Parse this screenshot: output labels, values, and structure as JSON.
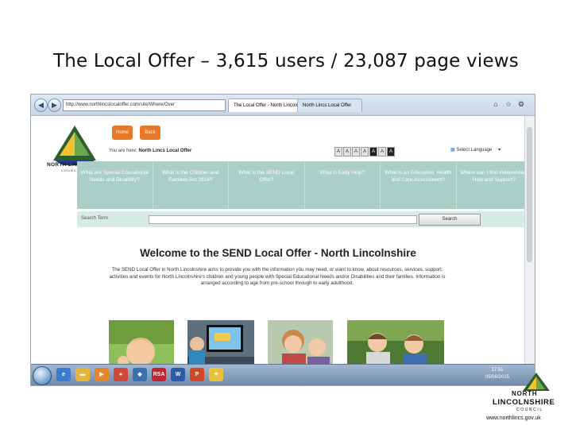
{
  "slide": {
    "title": "The Local Offer – 3,615 users / 23,087 page views"
  },
  "browser": {
    "address": "http://www.northlincslocaloffer.com/site/Where/Over",
    "tabs": [
      {
        "label": "The Local Offer - North Lincoln..."
      },
      {
        "label": "North Lincs Local Offer"
      }
    ]
  },
  "site": {
    "logo_text": "NORTH LINCOLNSHIRE",
    "logo_sub": "COUNCIL",
    "buttons": {
      "home": "Home",
      "back": "Back"
    },
    "breadcrumb_prefix": "You are here:",
    "breadcrumb_current": "North Lincs Local Offer",
    "text_size": [
      "A",
      "A",
      "A",
      "A",
      "A",
      "A",
      "A"
    ],
    "language": "Select Language",
    "nav": [
      "What are Special Educational Needs and Disability?",
      "What is the Children and Families Act 2014?",
      "What is the SEND Local Offer?",
      "What is Early Help?",
      "What is an Education, Health and Care Assessment?",
      "Where can I find Independent Help and Support?"
    ],
    "search": {
      "label": "Search Term",
      "button": "Search"
    },
    "welcome": "Welcome to the SEND Local Offer - North Lincolnshire",
    "intro": "The SEND Local Offer in North Lincolnshire aims to provide you with the information you may need, or want to know, about resources, services, support, activities and events for North Lincolnshire's children and young people with Special Educational Needs and/or Disabilities and their families. Information is arranged according to age from pre-school through to early adulthood."
  },
  "taskbar": {
    "icons": [
      "ie-icon",
      "folder-icon",
      "media-icon",
      "chrome-icon",
      "browser-icon",
      "rsa-icon",
      "word-icon",
      "powerpoint-icon",
      "app-icon"
    ],
    "rsa_label": "RSA",
    "word_label": "W",
    "ppt_label": "P",
    "clock_time": "17:51",
    "clock_date": "05/06/2015"
  },
  "footer": {
    "line1": "NORTH",
    "line2": "LINCOLNSHIRE",
    "line3": "COUNCIL",
    "url": "www.northlincs.gov.uk"
  },
  "colors": {
    "orange": "#e8782a",
    "nav_teal": "#a9cfc6",
    "search_bg": "#d6eae6"
  }
}
